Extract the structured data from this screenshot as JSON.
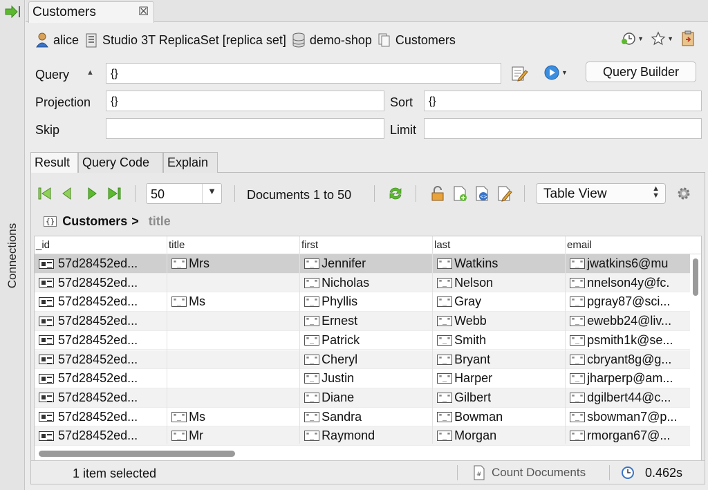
{
  "sidebar": {
    "label": "Connections"
  },
  "tab": {
    "title": "Customers",
    "close": "☒"
  },
  "breadcrumb": {
    "user": "alice",
    "server": "Studio 3T ReplicaSet [replica set]",
    "database": "demo-shop",
    "collection": "Customers"
  },
  "query": {
    "query_label": "Query",
    "query_value": "{}",
    "projection_label": "Projection",
    "projection_value": "{}",
    "sort_label": "Sort",
    "sort_value": "{}",
    "skip_label": "Skip",
    "skip_value": "",
    "limit_label": "Limit",
    "limit_value": "",
    "builder_label": "Query Builder"
  },
  "result_tabs": [
    "Result",
    "Query Code",
    "Explain"
  ],
  "toolbar": {
    "page_size": "50",
    "documents_text": "Documents 1 to 50",
    "view_mode": "Table View"
  },
  "path": {
    "root": "Customers",
    "separator": ">",
    "field": "title",
    "object_icon": "{}"
  },
  "table": {
    "columns": [
      "_id",
      "title",
      "first",
      "last",
      "email"
    ],
    "type_badge": "\"_\"",
    "rows": [
      [
        "57d28452ed...",
        "Mrs",
        "Jennifer",
        "Watkins",
        "jwatkins6@mu"
      ],
      [
        "57d28452ed...",
        "",
        "Nicholas",
        "Nelson",
        "nnelson4y@fc."
      ],
      [
        "57d28452ed...",
        "Ms",
        "Phyllis",
        "Gray",
        "pgray87@sci..."
      ],
      [
        "57d28452ed...",
        "",
        "Ernest",
        "Webb",
        "ewebb24@liv..."
      ],
      [
        "57d28452ed...",
        "",
        "Patrick",
        "Smith",
        "psmith1k@se..."
      ],
      [
        "57d28452ed...",
        "",
        "Cheryl",
        "Bryant",
        "cbryant8g@g..."
      ],
      [
        "57d28452ed...",
        "",
        "Justin",
        "Harper",
        "jharperp@am..."
      ],
      [
        "57d28452ed...",
        "",
        "Diane",
        "Gilbert",
        "dgilbert44@c..."
      ],
      [
        "57d28452ed...",
        "Ms",
        "Sandra",
        "Bowman",
        "sbowman7@p..."
      ],
      [
        "57d28452ed...",
        "Mr",
        "Raymond",
        "Morgan",
        "rmorgan67@..."
      ]
    ]
  },
  "status": {
    "selection": "1 item selected",
    "count_label": "Count Documents",
    "time": "0.462s"
  },
  "colors": {
    "accent_green": "#5cb82e",
    "selected_row": "#cfcfcf",
    "icon_blue": "#2f7fd8"
  }
}
